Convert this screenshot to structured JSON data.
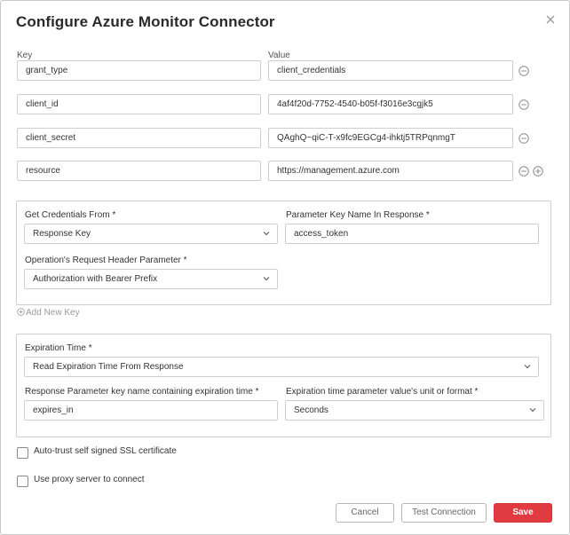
{
  "dialog": {
    "title": "Configure Azure Monitor Connector"
  },
  "params": {
    "key_label": "Key",
    "value_label": "Value",
    "rows": [
      {
        "key": "grant_type",
        "value": "client_credentials"
      },
      {
        "key": "client_id",
        "value": "4af4f20d-7752-4540-b05f-f3016e3cgjk5"
      },
      {
        "key": "client_secret",
        "value": "QAghQ~qiC-T-x9fc9EGCg4-ihktj5TRPqnmgT"
      },
      {
        "key": "resource",
        "value": "https://management.azure.com"
      }
    ]
  },
  "credentials": {
    "get_from_label": "Get Credentials From *",
    "get_from_value": "Response Key",
    "param_key_label": "Parameter Key Name In Response *",
    "param_key_value": "access_token",
    "header_param_label": "Operation's Request Header Parameter *",
    "header_param_value": "Authorization with Bearer Prefix"
  },
  "add_new_key": "Add New Key",
  "expiration": {
    "time_label": "Expiration Time *",
    "time_value": "Read Expiration Time From Response",
    "key_name_label": "Response Parameter key name containing expiration time *",
    "key_name_value": "expires_in",
    "unit_label": "Expiration time parameter value's unit or format *",
    "unit_value": "Seconds"
  },
  "options": {
    "ssl_label": "Auto-trust self signed SSL certificate",
    "proxy_label": "Use proxy server to connect"
  },
  "footer": {
    "cancel": "Cancel",
    "test": "Test Connection",
    "save": "Save"
  },
  "colors": {
    "primary": "#df3b41",
    "border": "#cfcfcf"
  }
}
